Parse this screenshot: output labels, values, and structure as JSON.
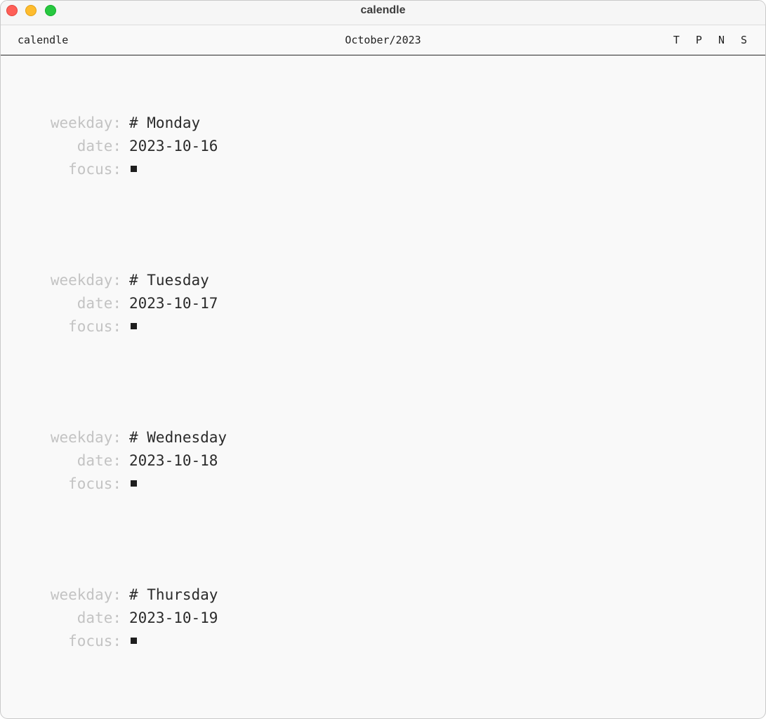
{
  "window": {
    "title": "calendle"
  },
  "header": {
    "app_name": "calendle",
    "month": "October/2023",
    "nav": [
      "T",
      "P",
      "N",
      "S"
    ]
  },
  "days": [
    {
      "weekday": "# Monday",
      "date": "2023-10-16"
    },
    {
      "weekday": "# Tuesday",
      "date": "2023-10-17"
    },
    {
      "weekday": "# Wednesday",
      "date": "2023-10-18"
    },
    {
      "weekday": "# Thursday",
      "date": "2023-10-19"
    }
  ],
  "labels": {
    "weekday": "weekday:",
    "date": "date:",
    "focus": "focus:"
  }
}
